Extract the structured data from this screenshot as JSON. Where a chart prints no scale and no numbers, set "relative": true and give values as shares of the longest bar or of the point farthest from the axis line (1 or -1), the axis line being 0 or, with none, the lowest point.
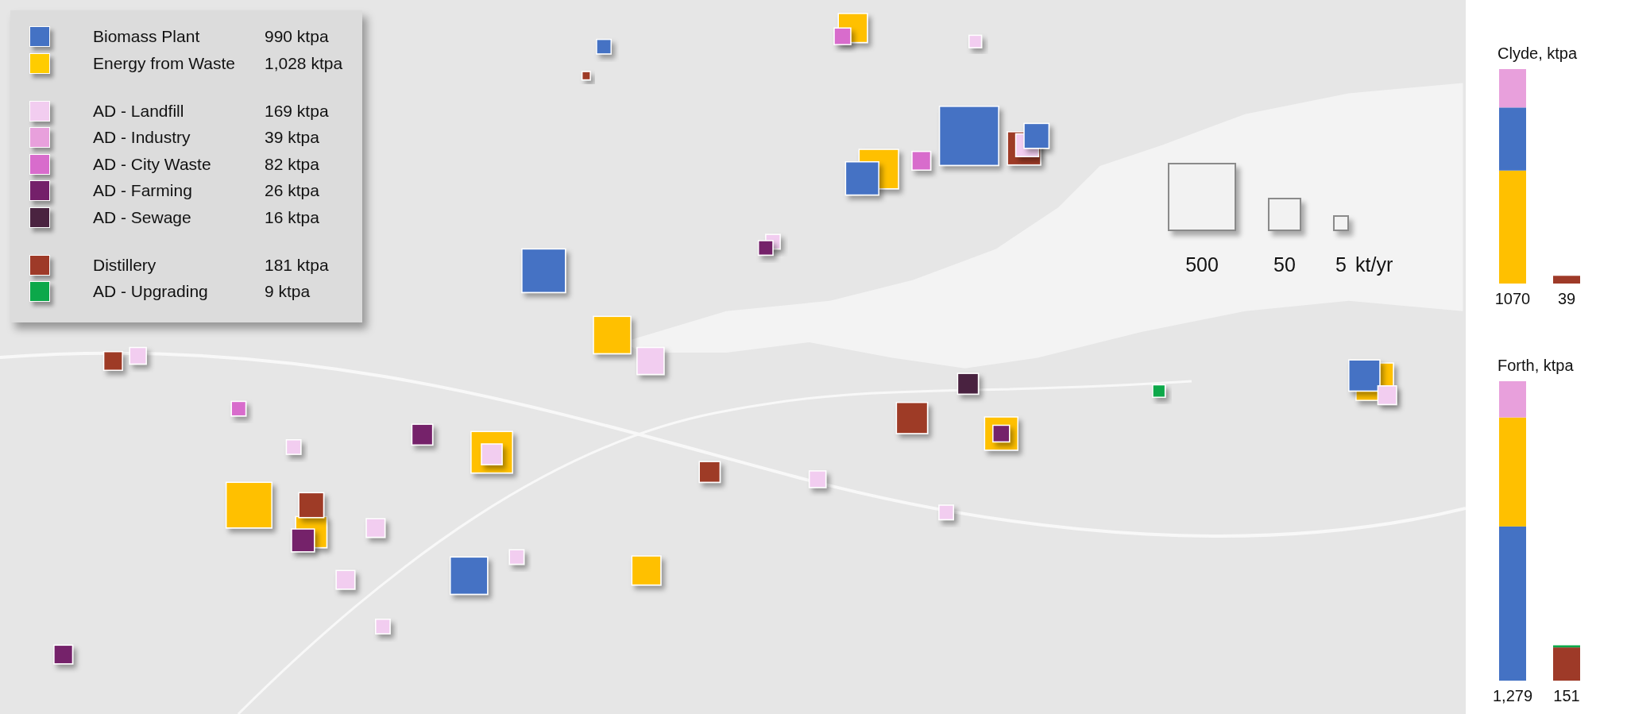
{
  "legend": {
    "groups": [
      {
        "items": [
          {
            "label": "Biomass Plant",
            "value": "990 ktpa",
            "color": "#4472c4"
          },
          {
            "label": "Energy from Waste",
            "value": "1,028 ktpa",
            "color": "#ffcc00"
          }
        ]
      },
      {
        "items": [
          {
            "label": "AD - Landfill",
            "value": "169 ktpa",
            "color": "#f2cdf0"
          },
          {
            "label": "AD - Industry",
            "value": "39 ktpa",
            "color": "#e8a0dc"
          },
          {
            "label": "AD - City Waste",
            "value": "82 ktpa",
            "color": "#d86ccc"
          },
          {
            "label": "AD - Farming",
            "value": "26 ktpa",
            "color": "#74206a"
          },
          {
            "label": "AD - Sewage",
            "value": "16 ktpa",
            "color": "#4a2340"
          }
        ]
      },
      {
        "items": [
          {
            "label": "Distillery",
            "value": "181 ktpa",
            "color": "#9e3a28"
          },
          {
            "label": "AD - Upgrading",
            "value": "9 ktpa",
            "color": "#0ca84a"
          }
        ]
      }
    ]
  },
  "size_legend": {
    "sizes": [
      "500",
      "50",
      "5"
    ],
    "unit": "kt/yr"
  },
  "charts": [
    {
      "title": "Clyde, ktpa",
      "chart_data": {
        "type": "bar",
        "stacked": true,
        "relative": true,
        "categories": [
          "1070",
          "39"
        ],
        "value_labels": [
          "1070",
          "39"
        ],
        "series": [
          {
            "color": "#ffc000",
            "values": [
              0.527,
              0
            ]
          },
          {
            "color": "#4472c4",
            "values": [
              0.294,
              0
            ]
          },
          {
            "color": "#e8a0dc",
            "values": [
              0.179,
              0
            ]
          },
          {
            "color": "#9e3a28",
            "values": [
              0,
              0.036
            ]
          }
        ]
      }
    },
    {
      "title": "Forth, ktpa",
      "chart_data": {
        "type": "bar",
        "stacked": true,
        "relative": true,
        "categories": [
          "1,279",
          "151"
        ],
        "value_labels": [
          "1,279",
          "151"
        ],
        "series": [
          {
            "color": "#4472c4",
            "values": [
              0.515,
              0
            ]
          },
          {
            "color": "#ffc000",
            "values": [
              0.364,
              0
            ]
          },
          {
            "color": "#e8a0dc",
            "values": [
              0.121,
              0
            ]
          },
          {
            "color": "#9e3a28",
            "values": [
              0,
              0.111
            ]
          },
          {
            "color": "#0ca84a",
            "values": [
              0,
              0.007
            ]
          }
        ]
      }
    }
  ]
}
